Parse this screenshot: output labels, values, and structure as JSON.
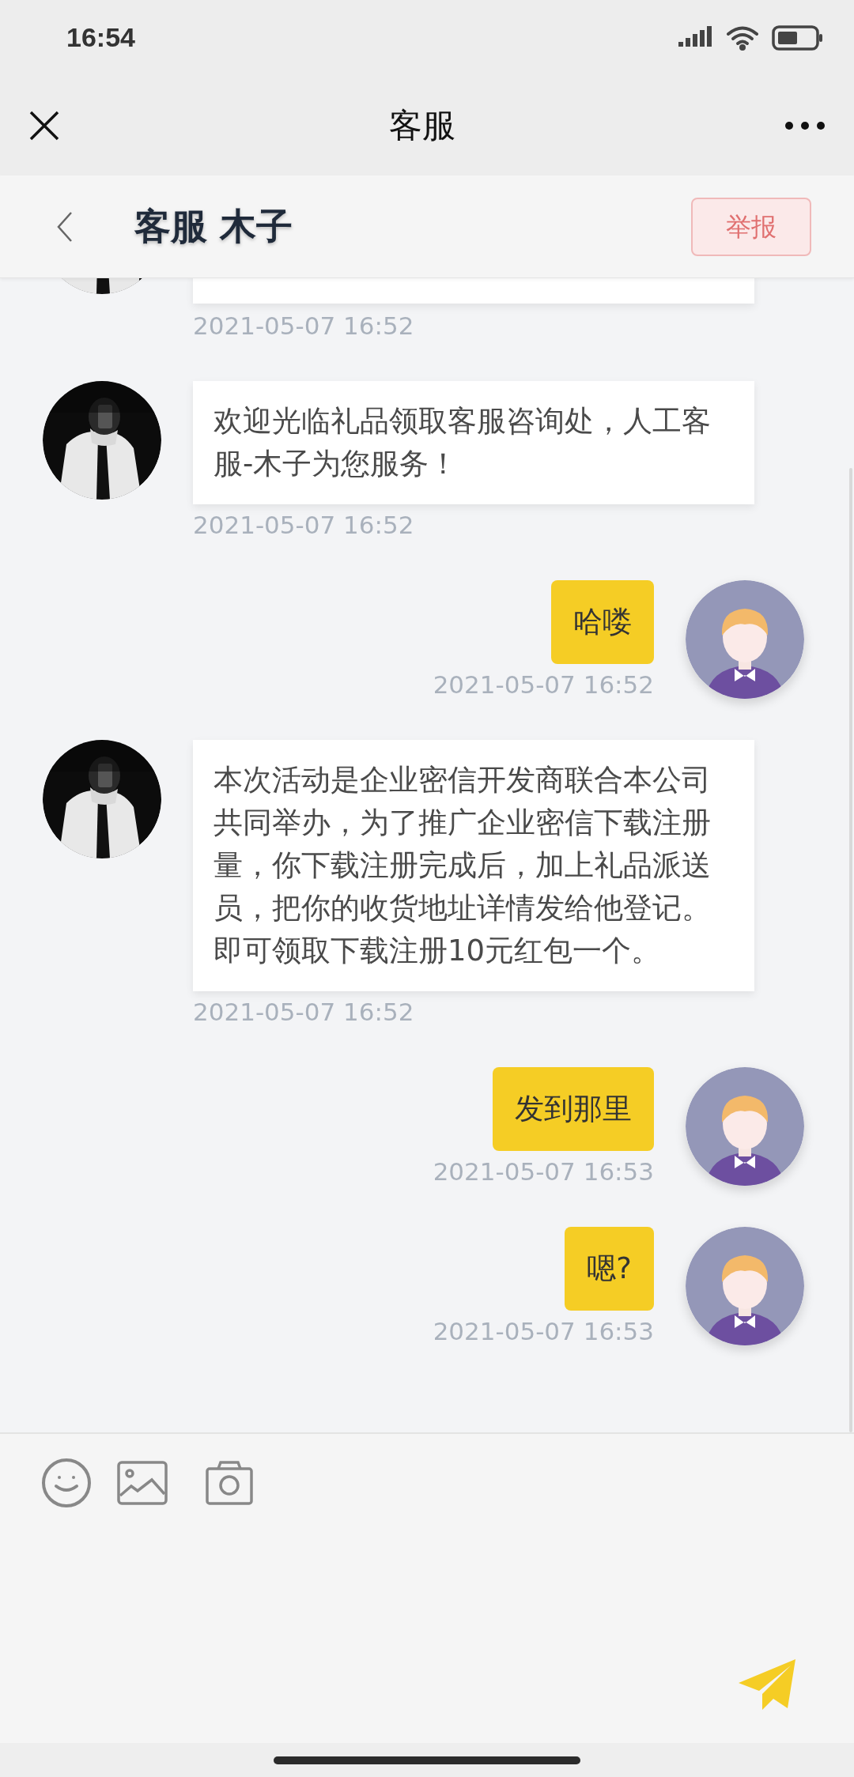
{
  "status_bar": {
    "time": "16:54"
  },
  "nav": {
    "title": "客服"
  },
  "header": {
    "title": "客服 木子",
    "report_button": "举报"
  },
  "messages": [
    {
      "kind": "cut",
      "time": "2021-05-07 16:52"
    },
    {
      "kind": "agent",
      "text": "欢迎光临礼品领取客服咨询处，人工客服-木子为您服务！",
      "time": "2021-05-07 16:52"
    },
    {
      "kind": "user",
      "text": "哈喽",
      "time": "2021-05-07 16:52"
    },
    {
      "kind": "agent",
      "text": "本次活动是企业密信开发商联合本公司共同举办，为了推广企业密信下载注册量，你下载注册完成后，加上礼品派送员，把你的收货地址详情发给他登记。即可领取下载注册10元红包一个。",
      "time": "2021-05-07 16:52"
    },
    {
      "kind": "user",
      "text": "发到那里",
      "time": "2021-05-07 16:53"
    },
    {
      "kind": "user",
      "text": "嗯?",
      "time": "2021-05-07 16:53"
    }
  ]
}
